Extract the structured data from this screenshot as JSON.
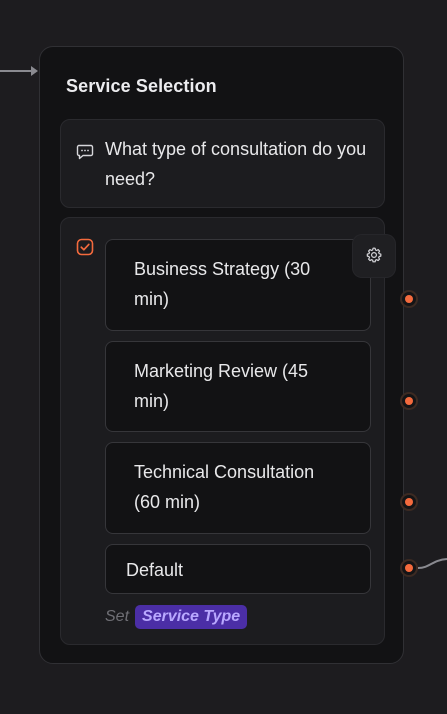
{
  "node": {
    "title": "Service Selection",
    "message": {
      "icon": "chat-bubble-icon",
      "text": "What type of consultation do you need?"
    },
    "choice": {
      "icon": "checkbox-icon",
      "items": [
        {
          "label": "Business Strategy (30 min)"
        },
        {
          "label": "Marketing Review (45 min)"
        },
        {
          "label": "Technical Consultation (60 min)"
        }
      ],
      "default_label": "Default",
      "settings_icon": "gear-icon",
      "set_prefix": "Set",
      "variable": "Service Type"
    }
  },
  "colors": {
    "canvas_bg": "#1d1c1f",
    "node_bg": "#121214",
    "block_bg": "#1c1c1f",
    "accent_orange": "#f46a3d",
    "variable_badge_bg": "#4b2ea6",
    "variable_badge_text": "#b9a8ff"
  }
}
